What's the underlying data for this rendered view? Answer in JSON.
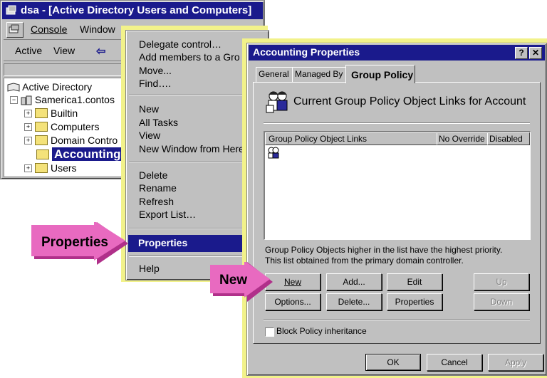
{
  "mmc": {
    "title": "dsa - [Active Directory Users and Computers]",
    "menu": {
      "console": "Console",
      "window": "Window"
    },
    "toolbar": {
      "action": "Active",
      "view": "View"
    },
    "tree": {
      "root": "Active Directory",
      "domain": "Samerica1.contos",
      "items": [
        "Builtin",
        "Computers",
        "Domain Contro",
        "Accounting",
        "Users"
      ]
    }
  },
  "context_menu": {
    "items": [
      "Delegate control…",
      "Add members to a Gro",
      "Move...",
      "Find…."
    ],
    "items2": [
      "New",
      "All Tasks",
      "View",
      "New Window from Here"
    ],
    "items3": [
      "Delete",
      "Rename",
      "Refresh",
      "Export List…"
    ],
    "properties": "Properties",
    "help": "Help"
  },
  "dialog": {
    "title": "Accounting Properties",
    "help_btn": "?",
    "close_btn": "✕",
    "tabs": [
      "General",
      "Managed By",
      "Group Policy"
    ],
    "header": "Current Group Policy Object Links for Account",
    "columns": [
      "Group Policy Object Links",
      "No Override",
      "Disabled"
    ],
    "note1": "Group Policy Objects higher in the list have the highest priority.",
    "note2": "This list obtained from the primary domain controller.",
    "buttons": {
      "new": "New",
      "add": "Add...",
      "edit": "Edit",
      "up": "Up",
      "options": "Options...",
      "delete": "Delete...",
      "properties": "Properties",
      "down": "Down"
    },
    "block_inheritance": "Block Policy inheritance",
    "ok": "OK",
    "cancel": "Cancel",
    "apply": "Apply"
  },
  "callouts": {
    "properties": "Properties",
    "new": "New"
  },
  "colors": {
    "titlebar": "#1a1a8c",
    "highlight": "#1a1a8c",
    "callout": "#e040a0",
    "shadow": "#f2f28a"
  }
}
